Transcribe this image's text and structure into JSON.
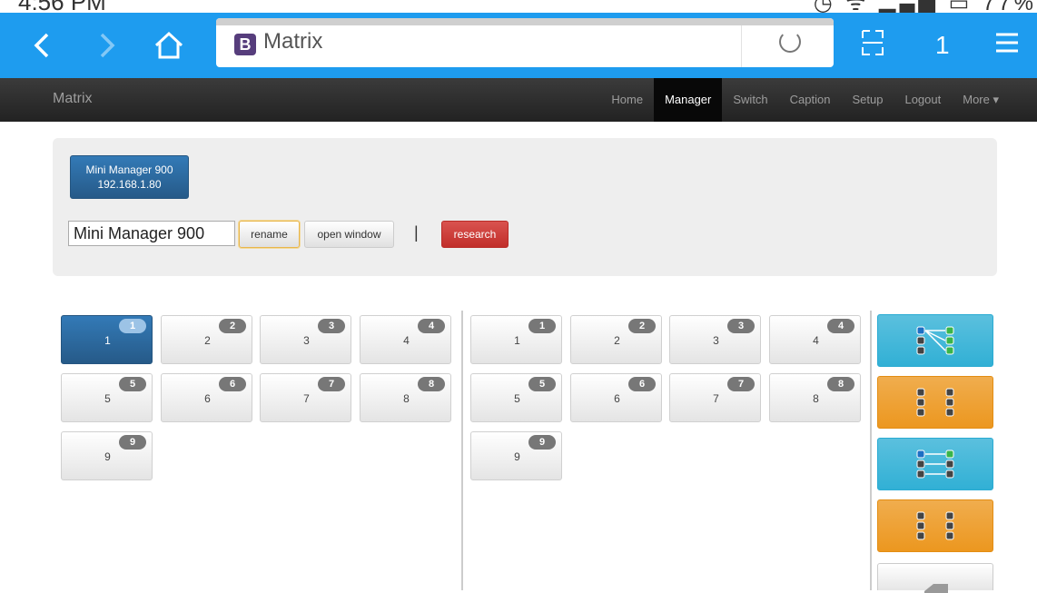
{
  "status_bar": {
    "time": "4:56 PM",
    "icons": [
      "alarm-icon",
      "wifi-icon",
      "signal-icon",
      "battery-icon"
    ],
    "battery": "77%"
  },
  "browser": {
    "address_text": "Matrix",
    "tab_count": "1",
    "favicon_letter": "B",
    "chrome_color": "#1e9cef"
  },
  "navbar": {
    "brand": "Matrix",
    "links": [
      {
        "label": "Home",
        "active": false
      },
      {
        "label": "Manager",
        "active": true
      },
      {
        "label": "Switch",
        "active": false
      },
      {
        "label": "Caption",
        "active": false
      },
      {
        "label": "Setup",
        "active": false
      },
      {
        "label": "Logout",
        "active": false
      },
      {
        "label": "More ▾",
        "active": false
      }
    ]
  },
  "manager": {
    "device_name": "Mini Manager 900",
    "device_ip": "192.168.1.80",
    "name_input_value": "Mini Manager 900",
    "rename_label": "rename",
    "open_window_label": "open window",
    "separator": "|",
    "research_label": "research"
  },
  "inputs_grid": {
    "selected": "1",
    "tiles": [
      {
        "label": "1",
        "badge": "1"
      },
      {
        "label": "2",
        "badge": "2"
      },
      {
        "label": "3",
        "badge": "3"
      },
      {
        "label": "4",
        "badge": "4"
      },
      {
        "label": "5",
        "badge": "5"
      },
      {
        "label": "6",
        "badge": "6"
      },
      {
        "label": "7",
        "badge": "7"
      },
      {
        "label": "8",
        "badge": "8"
      },
      {
        "label": "9",
        "badge": "9"
      }
    ]
  },
  "outputs_grid": {
    "tiles": [
      {
        "label": "1",
        "badge": "1"
      },
      {
        "label": "2",
        "badge": "2"
      },
      {
        "label": "3",
        "badge": "3"
      },
      {
        "label": "4",
        "badge": "4"
      },
      {
        "label": "5",
        "badge": "5"
      },
      {
        "label": "6",
        "badge": "6"
      },
      {
        "label": "7",
        "badge": "7"
      },
      {
        "label": "8",
        "badge": "8"
      },
      {
        "label": "9",
        "badge": "9"
      }
    ]
  },
  "side_actions": [
    {
      "icon": "route-all-icon",
      "color": "#5bc0de"
    },
    {
      "icon": "clear-routes-icon",
      "color": "#f0ad4e"
    },
    {
      "icon": "one-to-one-icon",
      "color": "#5bc0de"
    },
    {
      "icon": "clear-one-to-one-icon",
      "color": "#f0ad4e"
    },
    {
      "icon": "back-icon",
      "color": "#ffffff"
    }
  ]
}
